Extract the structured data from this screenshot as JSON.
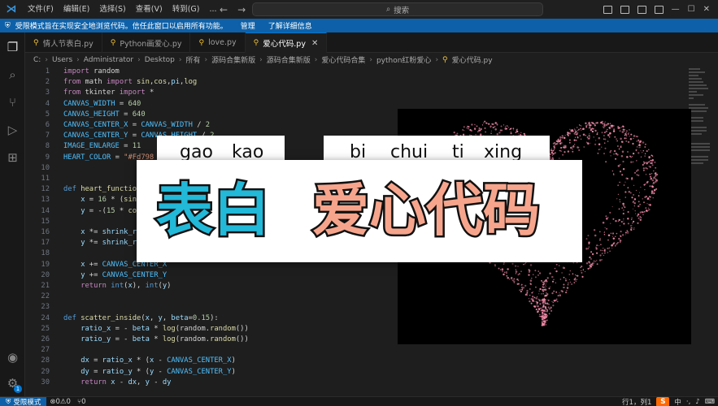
{
  "titlebar": {
    "menu": [
      "文件(F)",
      "编辑(E)",
      "选择(S)",
      "查看(V)",
      "转到(G)",
      "..."
    ],
    "search_label": "搜索"
  },
  "banner": {
    "text": "受限模式旨在实现安全地浏览代码。信任此窗口以启用所有功能。",
    "manage_link": "管理",
    "learn_link": "了解详细信息"
  },
  "tabs": [
    {
      "label": "情人节表白.py",
      "active": false
    },
    {
      "label": "Python画爱心.py",
      "active": false
    },
    {
      "label": "love.py",
      "active": false
    },
    {
      "label": "爱心代码.py",
      "active": true
    }
  ],
  "breadcrumb": [
    "C:",
    "Users",
    "Administrator",
    "Desktop",
    "所有",
    "源码合集新版",
    "源码合集新版",
    "爱心代码合集",
    "python红粉爱心",
    "爱心代码.py"
  ],
  "code_line_numbers": [
    "1",
    "2",
    "3",
    "4",
    "5",
    "6",
    "7",
    "8",
    "9",
    "10",
    "11",
    "12",
    "13",
    "14",
    "15",
    "16",
    "17",
    "18",
    "19",
    "20",
    "21",
    "22",
    "23",
    "24",
    "25",
    "26",
    "27",
    "28",
    "29",
    "30"
  ],
  "overlay": {
    "pinyin_left": [
      "gao",
      "kao"
    ],
    "pinyin_right": [
      "bi",
      "chui",
      "ti",
      "xing"
    ],
    "title_left": "表白",
    "title_right": "爱心代码"
  },
  "statusbar": {
    "restricted": "受限模式",
    "problems": "⊗0⚠0",
    "ports": "⑂0",
    "position": "行1，列1",
    "ime": "中"
  },
  "colors": {
    "banner": "#0e61a8",
    "title_cyan": "#22b8d8",
    "title_pink": "#f6a58c",
    "heart_pink": "#f08aa8"
  }
}
